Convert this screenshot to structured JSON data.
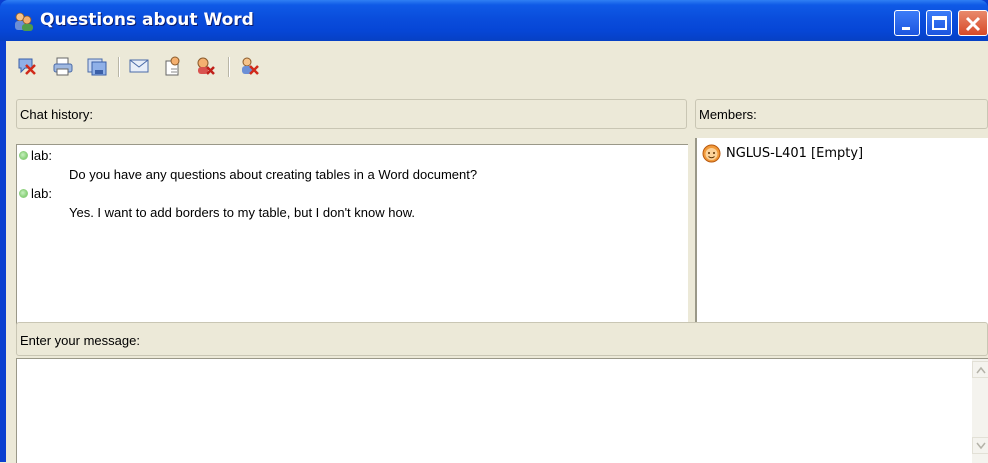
{
  "window": {
    "title": "Questions about Word",
    "icon": "chat-people-icon"
  },
  "toolbar": {
    "buttons": [
      {
        "name": "leave-chat-icon"
      },
      {
        "name": "print-icon"
      },
      {
        "name": "save-icon"
      },
      {
        "name": "send-mail-icon"
      },
      {
        "name": "invite-icon"
      },
      {
        "name": "remove-member-icon"
      },
      {
        "name": "close-chat-icon"
      }
    ]
  },
  "chat": {
    "header": "Chat history:",
    "messages": [
      {
        "user": "lab:",
        "text": "Do you have any questions about creating tables in a Word document?"
      },
      {
        "user": "lab:",
        "text": "Yes. I want to add borders to my table, but I don't know how."
      }
    ]
  },
  "members": {
    "header": "Members:",
    "list": [
      {
        "name": "NGLUS-L401 [Empty]",
        "icon": "user-face-icon"
      }
    ]
  },
  "input": {
    "header": "Enter your message:",
    "value": ""
  },
  "colors": {
    "titlebar": "#0a4ddc",
    "window_face": "#ece9d8",
    "close_button": "#d84a28",
    "online_dot": "#6fc45d"
  }
}
